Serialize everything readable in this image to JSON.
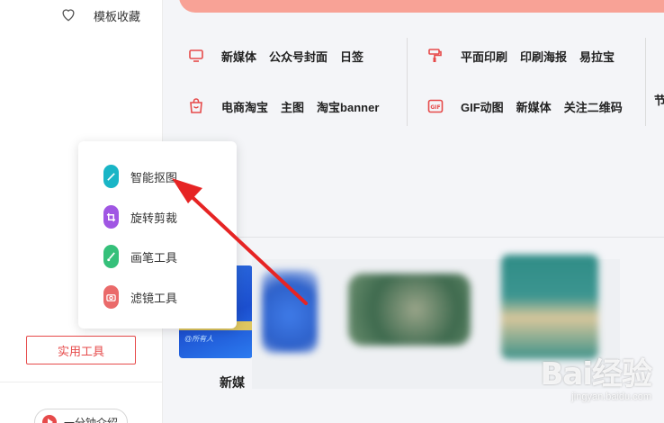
{
  "sidebar": {
    "favorites_label": "模板收藏",
    "utility_button": "实用工具",
    "one_minute_label": "一分钟介绍"
  },
  "categories": {
    "row1_left": [
      "新媒体",
      "公众号封面",
      "日签"
    ],
    "row1_right": [
      "平面印刷",
      "印刷海报",
      "易拉宝"
    ],
    "row2_left": [
      "电商淘宝",
      "主图",
      "淘宝banner"
    ],
    "row2_right": [
      "GIF动图",
      "新媒体",
      "关注二维码"
    ],
    "partial_next": "节"
  },
  "popup_menu": {
    "items": [
      {
        "label": "智能抠图",
        "icon": "magic-wand-icon",
        "color": "#19b5c6"
      },
      {
        "label": "旋转剪裁",
        "icon": "crop-icon",
        "color": "#a056e3"
      },
      {
        "label": "画笔工具",
        "icon": "brush-icon",
        "color": "#35c07a"
      },
      {
        "label": "滤镜工具",
        "icon": "camera-icon",
        "color": "#ea6a6a"
      }
    ]
  },
  "cards": {
    "first_label": "新媒",
    "thumb_text": "@所有人"
  },
  "watermark": {
    "brand": "Bai经验",
    "url": "jingyan.baidu.com"
  },
  "colors": {
    "accent": "#e64a4a",
    "banner": "#f8a296"
  }
}
